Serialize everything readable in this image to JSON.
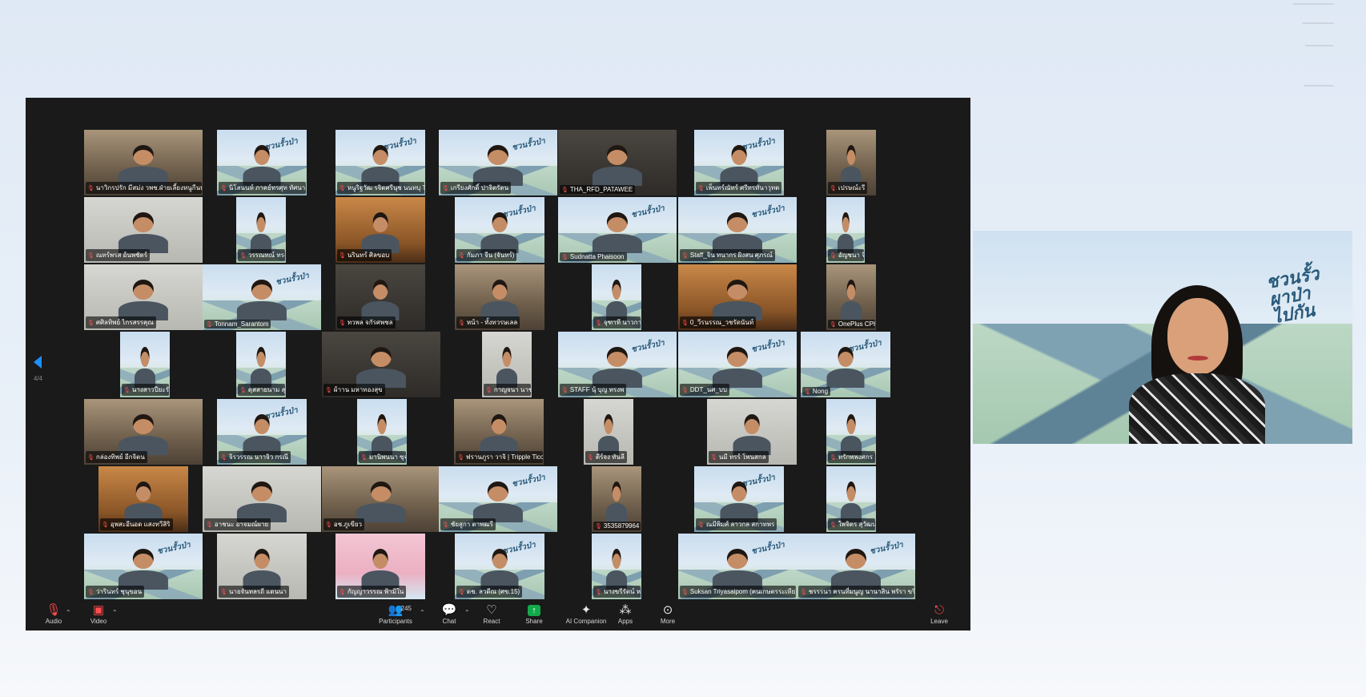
{
  "gallery": {
    "page_indicator": "4/4",
    "participants": [
      {
        "name": "นาวิกรปรัก มีสม่ง วพช.ฝ่ายเลี้ยงหนูกีนทั่วไป",
        "style": "room"
      },
      {
        "name": "นิโลนนท์ ภาคย์ทรศุท ทัศนา",
        "style": "mtn"
      },
      {
        "name": "หนูริฐวัฒ รจิตศรีนุช นนทบุ Tgr",
        "style": "mtn"
      },
      {
        "name": "เกรียงศักดิ์ ปาจิตรัตน",
        "style": "mtn"
      },
      {
        "name": "THA_RFD_PATAWEE",
        "style": "dark"
      },
      {
        "name": "เพ็นทร์ณัทร์ ศรีทรทันาวุทต",
        "style": "mtn"
      },
      {
        "name": "เปรษณ์ะรี",
        "style": "room"
      },
      {
        "name": "ณทร์พรส อ้นพชัดร์",
        "style": "gray"
      },
      {
        "name": "วรรณทณ์ ทรงเศร นครา",
        "style": "mtn"
      },
      {
        "name": "นรินทร์ ศิลขอบ",
        "style": "warm"
      },
      {
        "name": "กัมภา จีน (จันทร์)",
        "style": "mtn"
      },
      {
        "name": "Sudnatta Phaisoon",
        "style": "mtn"
      },
      {
        "name": "Staff_จิน ทนากร ผิงสน ศุภรณ์",
        "style": "mtn"
      },
      {
        "name": "อัญชนา จิตร",
        "style": "mtn"
      },
      {
        "name": "ศศิลทิพย์ ไกรสรรคุณ",
        "style": "gray"
      },
      {
        "name": "Tonnam_Sarantom",
        "style": "mtn"
      },
      {
        "name": "ทวพล จกัรศพชล",
        "style": "dark"
      },
      {
        "name": "หน้า - ทั้งทวรษเลล",
        "style": "room"
      },
      {
        "name": "จุฑาที นาวกาสรรค",
        "style": "mtn"
      },
      {
        "name": "0_วีรนรรณ_วชรัดนันท์",
        "style": "warm"
      },
      {
        "name": "OnePlus CPH2465",
        "style": "room"
      },
      {
        "name": "นางสาวปียะรัตน์ พรร",
        "style": "mtn"
      },
      {
        "name": "ดุสสายนาม สุรรัก",
        "style": "mtn"
      },
      {
        "name": "ผ้าาน มหาทองสุข",
        "style": "dark"
      },
      {
        "name": "กาญจนา นาขสอง ทรรา",
        "style": "gray"
      },
      {
        "name": "STAFF นุ้ บุญ ทรงพ",
        "style": "mtn"
      },
      {
        "name": "DDT_นศ_บบ",
        "style": "mtn"
      },
      {
        "name": "Nong",
        "style": "mtn"
      },
      {
        "name": "กล่องทิพย์ อีกจิตน",
        "style": "room"
      },
      {
        "name": "จิรวรรณ นาาจิว กรณี",
        "style": "mtn"
      },
      {
        "name": "มานิพนนา ซุจปาดสรีส บ้านนา Barn Na Cr...",
        "style": "mtn"
      },
      {
        "name": "ฟรานภูรา วาจิ | Tripple Ticoda",
        "style": "room"
      },
      {
        "name": "ตีร์จง ทันลี",
        "style": "gray"
      },
      {
        "name": "นมี ทรร์ โพนสกล",
        "style": "gray"
      },
      {
        "name": "ทรักพพงศกร",
        "style": "mtn"
      },
      {
        "name": "อุพสะอีนอด แสงทวีสิริ",
        "style": "warm"
      },
      {
        "name": "อาชนะ อาจมณ์ผาย",
        "style": "gray"
      },
      {
        "name": "อช.ภูเขียว",
        "style": "room"
      },
      {
        "name": "ชัยสูกา ตาพฒรี",
        "style": "mtn"
      },
      {
        "name": "3535879964",
        "style": "room"
      },
      {
        "name": "ณมีพิมศ์ ลาวกล สกาทพร",
        "style": "mtn"
      },
      {
        "name": "ใพจิตร สุวัฒนาภรณ์",
        "style": "mtn"
      },
      {
        "name": "ว่ารินทร์ ชุนุขอน",
        "style": "mtn"
      },
      {
        "name": "นายจันทลรถี แดนนา",
        "style": "gray"
      },
      {
        "name": "กัญญาวรรณ ฟ้ามีใน",
        "style": "pink"
      },
      {
        "name": "ตช. ลวดีณ (ศข.15)",
        "style": "mtn"
      },
      {
        "name": "นางขรีรัตน์ หนัคสิน",
        "style": "mtn"
      },
      {
        "name": "Suksan Triyasaipom (คนเกษตรระเทีย)",
        "style": "mtn"
      },
      {
        "name": "ชรรรนา ครนที่มนูญ นานาสิน พรัรา ขริยนิตน",
        "style": "mtn"
      }
    ]
  },
  "toolbar": {
    "audio": "Audio",
    "video": "Video",
    "participants": "Participants",
    "participant_count": "245",
    "chat": "Chat",
    "react": "React",
    "share": "Share",
    "ai_companion": "AI Companion",
    "apps": "Apps",
    "more": "More",
    "leave": "Leave"
  },
  "speaker": {
    "logo_line1": "ชวนรั้ว",
    "logo_line2": "ผาป่า",
    "logo_line3": "ไปกัน"
  },
  "tile_logo": "ชวนรั้วป่า",
  "colors": {
    "window_bg": "#1a1a1a",
    "share_green": "#12a94a",
    "muted_red": "#ff4d4d",
    "page_arrow_blue": "#1e8fff"
  }
}
